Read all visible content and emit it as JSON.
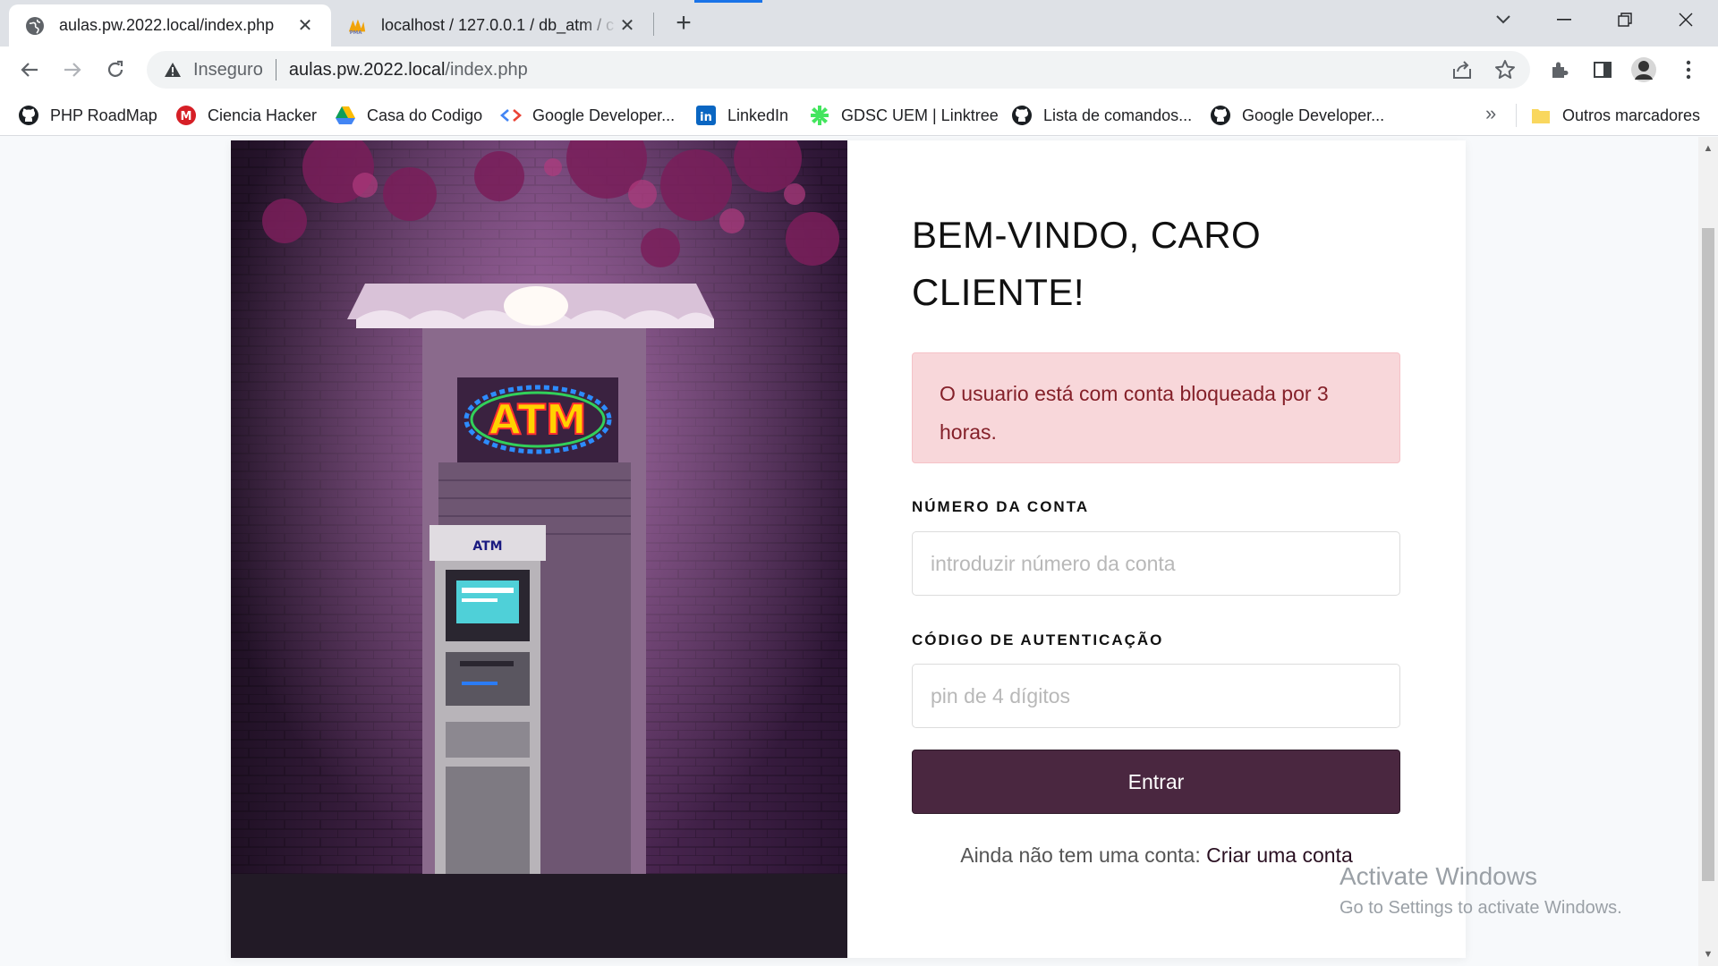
{
  "browser": {
    "tabs": [
      {
        "title": "aulas.pw.2022.local/index.php",
        "active": true,
        "favicon": "globe-icon"
      },
      {
        "title": "localhost / 127.0.0.1 / db_atm / c",
        "active": false,
        "favicon": "phpmyadmin-icon"
      }
    ],
    "address": {
      "security_label": "Inseguro",
      "host": "aulas.pw.2022.local",
      "path": "/index.php"
    },
    "bookmarks": [
      {
        "label": "PHP RoadMap",
        "icon": "github-icon"
      },
      {
        "label": "Ciencia Hacker",
        "icon": "red-m-icon"
      },
      {
        "label": "Casa do Codigo",
        "icon": "drive-icon"
      },
      {
        "label": "Google Developer...",
        "icon": "google-dev-icon"
      },
      {
        "label": "LinkedIn",
        "icon": "linkedin-icon"
      },
      {
        "label": "GDSC UEM | Linktree",
        "icon": "linktree-icon"
      },
      {
        "label": "Lista de comandos...",
        "icon": "github-icon"
      },
      {
        "label": "Google Developer...",
        "icon": "github-icon"
      }
    ],
    "bookmarks_more": "»",
    "other_bookmarks": "Outros marcadores"
  },
  "hero": {
    "sign_text": "ATM",
    "machine_text": "ATM",
    "accent": "#6a2a6e"
  },
  "login": {
    "heading": "BEM-VINDO, CARO CLIENTE!",
    "alert": "O usuario está com conta bloqueada por 3 horas.",
    "account_label": "NÚMERO DA CONTA",
    "account_placeholder": "introduzir número da conta",
    "pin_label": "CÓDIGO DE AUTENTICAÇÃO",
    "pin_placeholder": "pin de 4 dígitos",
    "submit_label": "Entrar",
    "signup_prompt": "Ainda não tem uma conta:",
    "signup_link": "Criar uma conta"
  },
  "watermark": {
    "line1": "Activate Windows",
    "line2": "Go to Settings to activate Windows."
  },
  "colors": {
    "button_bg": "#4a2740",
    "alert_bg": "#f8d7da",
    "alert_text": "#842029"
  }
}
